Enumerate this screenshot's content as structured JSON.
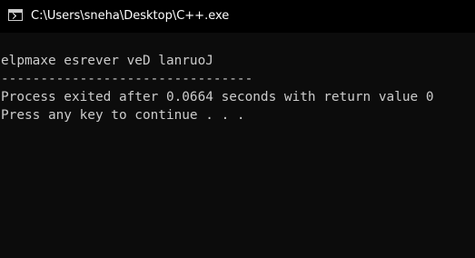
{
  "window": {
    "title": "C:\\Users\\sneha\\Desktop\\C++.exe",
    "app_icon": "console-icon"
  },
  "console": {
    "lines": [
      "elpmaxe esrever veD lanruoJ",
      "--------------------------------",
      "Process exited after 0.0664 seconds with return value 0",
      "Press any key to continue . . ."
    ]
  },
  "colors": {
    "titlebar_bg": "#000000",
    "console_bg": "#0c0c0c",
    "console_text": "#cccccc",
    "title_text": "#ffffff"
  }
}
